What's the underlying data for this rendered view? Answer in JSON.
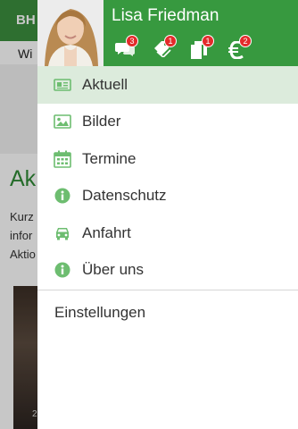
{
  "colors": {
    "brand_green": "#37993f",
    "icon_green": "#6dbd70",
    "active_row": "#dcebdc",
    "badge_red": "#e32b2b"
  },
  "background": {
    "header_title": "BH",
    "subtitle": "Wi",
    "heading": "Ak",
    "text_lines": [
      "Kurz",
      "infor",
      "Aktio"
    ],
    "photo_caption": "2"
  },
  "drawer": {
    "user": {
      "name": "Lisa Friedman",
      "avatar": "user-avatar-photo"
    },
    "notifications": [
      {
        "icon": "chat-icon",
        "count": "3"
      },
      {
        "icon": "tag-icon",
        "count": "1"
      },
      {
        "icon": "documents-icon",
        "count": "1"
      },
      {
        "icon": "euro-icon",
        "count": "2"
      }
    ],
    "menu": [
      {
        "label": "Aktuell",
        "icon": "newspaper-icon",
        "active": true
      },
      {
        "label": "Bilder",
        "icon": "image-icon",
        "active": false
      },
      {
        "label": "Termine",
        "icon": "calendar-icon",
        "active": false
      },
      {
        "label": "Datenschutz",
        "icon": "info-icon",
        "active": false
      },
      {
        "label": "Anfahrt",
        "icon": "car-icon",
        "active": false
      },
      {
        "label": "Über uns",
        "icon": "info-icon",
        "active": false
      }
    ],
    "settings_label": "Einstellungen"
  }
}
